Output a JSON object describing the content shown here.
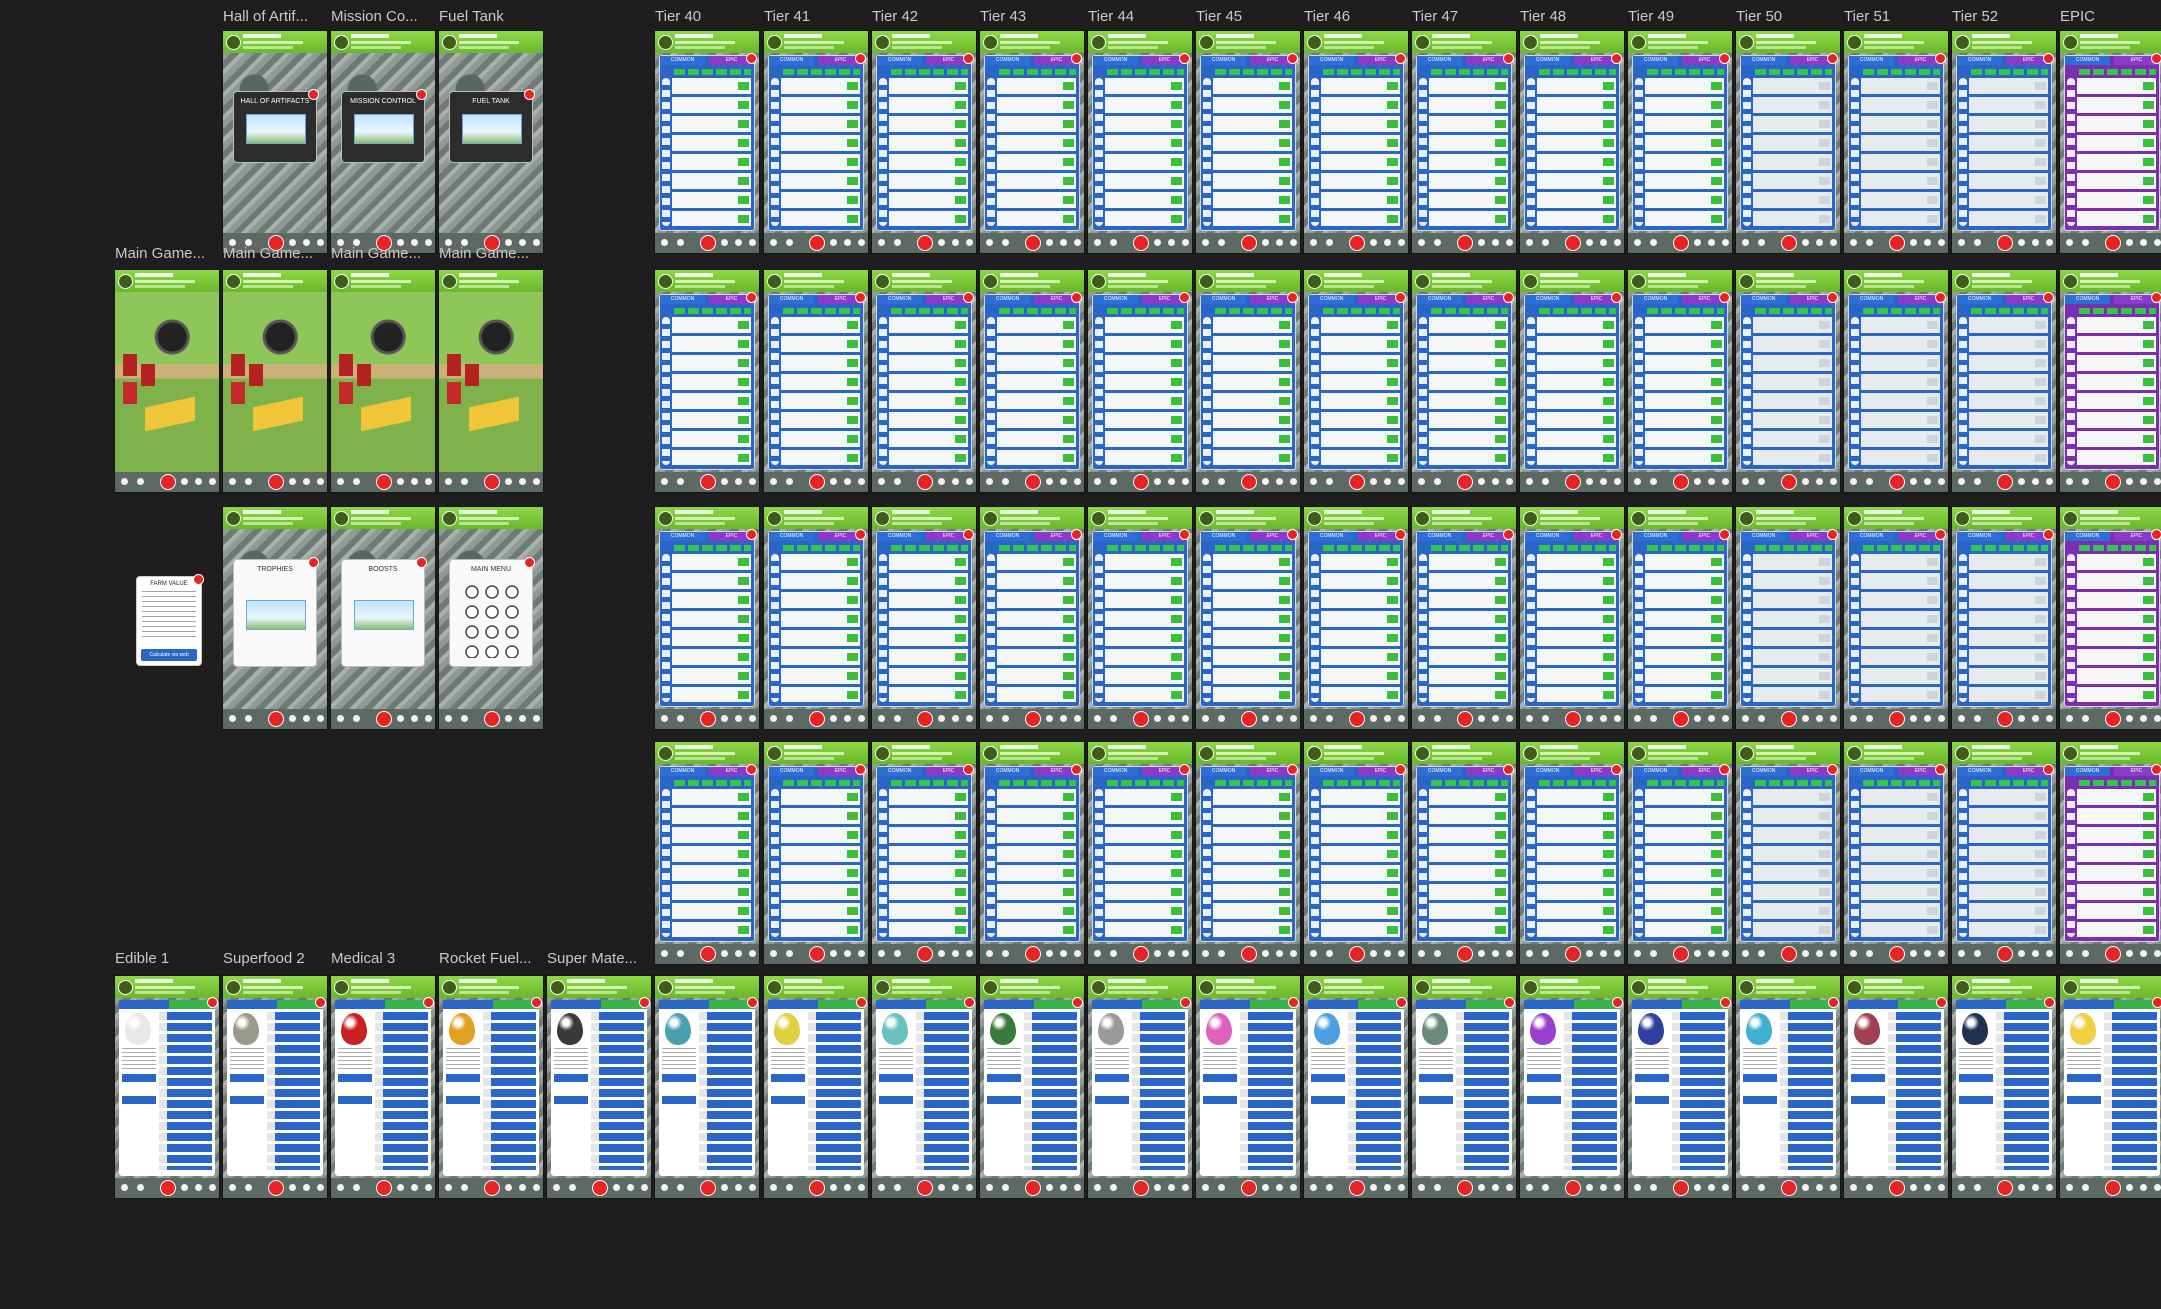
{
  "canvas_bg": "#1e1e1e",
  "top_labels": {
    "hall": "Hall of Artif...",
    "mission": "Mission Co...",
    "fuel": "Fuel Tank"
  },
  "main_label": "Main Game...",
  "dialogs": {
    "hall": "HALL OF ARTIFACTS",
    "mission": "MISSION CONTROL",
    "fuel": "FUEL TANK",
    "trophies": "TROPHIES",
    "boosts": "BOOSTS",
    "main_menu": "MAIN MENU",
    "farm_value": "FARM VALUE",
    "farm_value_button": "Calculate via web"
  },
  "tier_labels": [
    "Tier 40",
    "Tier 41",
    "Tier 42",
    "Tier 43",
    "Tier 44",
    "Tier 45",
    "Tier 46",
    "Tier 47",
    "Tier 48",
    "Tier 49",
    "Tier 50",
    "Tier 51",
    "Tier 52",
    "EPIC"
  ],
  "egg_labels": [
    "Edible 1",
    "Superfood 2",
    "Medical 3",
    "Rocket Fuel...",
    "Super Mate..."
  ],
  "egg_colors": [
    "#e8e8e8",
    "#9a9a8a",
    "#c92020",
    "#e0a020",
    "#3a3a3a",
    "#4aa0b0",
    "#e0d040",
    "#6bc0c0",
    "#3a7a3a",
    "#9a9a9a",
    "#e060c0",
    "#4aa0e0",
    "#6a8a7a",
    "#9a40d0",
    "#3040a0",
    "#40b0d0",
    "#a04050",
    "#203050",
    "#f0d040"
  ],
  "tab_common": "COMMON",
  "tab_epic": "EPIC"
}
